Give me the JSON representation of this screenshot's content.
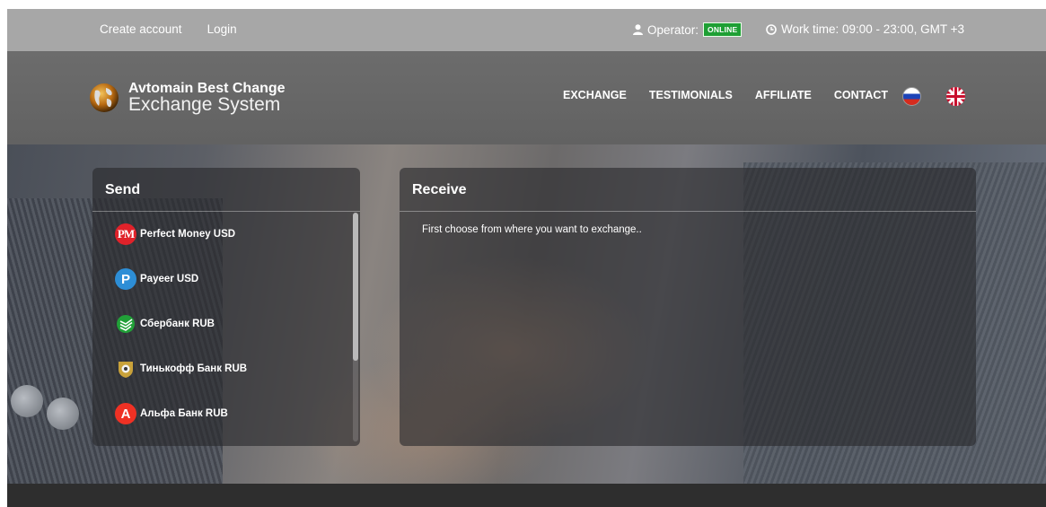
{
  "topbar": {
    "create_account": "Create account",
    "login": "Login",
    "operator_label": "Operator:",
    "operator_status": "ONLINE",
    "work_time": "Work time: 09:00 - 23:00, GMT +3"
  },
  "header": {
    "logo_line1": "Avtomain Best Change",
    "logo_line2": "Exchange System",
    "nav": [
      "EXCHANGE",
      "TESTIMONIALS",
      "AFFILIATE",
      "CONTACT"
    ]
  },
  "send": {
    "title": "Send",
    "items": [
      {
        "label": "Perfect Money USD",
        "icon": "perfect-money-icon",
        "icon_text": "PM"
      },
      {
        "label": "Payeer USD",
        "icon": "payeer-icon",
        "icon_text": "P"
      },
      {
        "label": "Сбербанк RUB",
        "icon": "sberbank-icon",
        "icon_text": ""
      },
      {
        "label": "Тинькофф Банк RUB",
        "icon": "tinkoff-icon",
        "icon_text": ""
      },
      {
        "label": "Альфа Банк RUB",
        "icon": "alfa-bank-icon",
        "icon_text": "A"
      }
    ]
  },
  "receive": {
    "title": "Receive",
    "hint": "First choose from where you want to exchange.."
  },
  "colors": {
    "online_badge": "#1e9f34",
    "topbar": "#a7a7a7",
    "header": "#666666",
    "footer": "#2e2e2e"
  }
}
